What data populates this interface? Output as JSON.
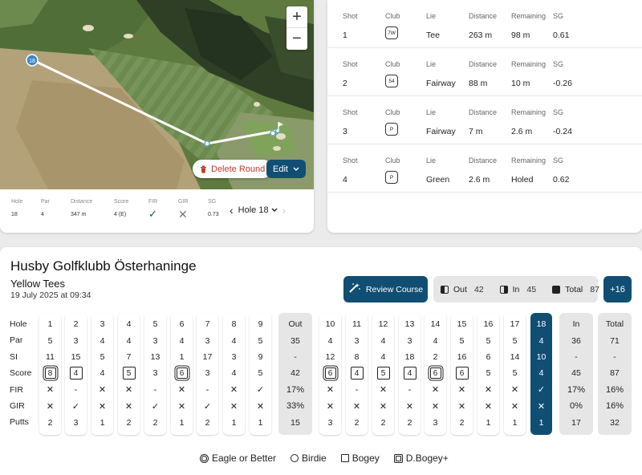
{
  "map": {
    "marker_label": "18",
    "zoom_in": "+",
    "zoom_out": "−",
    "delete_label": "Delete Round",
    "edit_label": "Edit"
  },
  "hole_stats": {
    "headers": [
      "Hole",
      "Par",
      "Distance",
      "Score",
      "FIR",
      "GIR",
      "SG"
    ],
    "hole": "18",
    "par": "4",
    "distance": "347 m",
    "score": "4 (E)",
    "fir": "✓",
    "gir": "✕",
    "sg": "0.73"
  },
  "hole_nav": {
    "label": "Hole 18",
    "prev": "‹",
    "next": "›"
  },
  "shots": {
    "headers": {
      "shot": "Shot",
      "club": "Club",
      "lie": "Lie",
      "distance": "Distance",
      "remaining": "Remaining",
      "sg": "SG"
    },
    "rows": [
      {
        "shot": "1",
        "club": "7W",
        "lie": "Tee",
        "distance": "263 m",
        "remaining": "98 m",
        "sg": "0.61"
      },
      {
        "shot": "2",
        "club": "54",
        "lie": "Fairway",
        "distance": "88 m",
        "remaining": "10 m",
        "sg": "-0.26"
      },
      {
        "shot": "3",
        "club": "P",
        "lie": "Fairway",
        "distance": "7 m",
        "remaining": "2.6 m",
        "sg": "-0.24"
      },
      {
        "shot": "4",
        "club": "P",
        "lie": "Green",
        "distance": "2.6 m",
        "remaining": "Holed",
        "sg": "0.62"
      }
    ]
  },
  "round": {
    "course": "Husby Golfklubb Österhaninge",
    "tees": "Yellow Tees",
    "date": "19 July 2025 at 09:34",
    "review_label": "Review Course",
    "out_label": "Out",
    "out_value": "42",
    "in_label": "In",
    "in_value": "45",
    "total_label": "Total",
    "total_value": "87",
    "plus_label": "+16"
  },
  "scorecard": {
    "row_labels": [
      "Hole",
      "Par",
      "SI",
      "Score",
      "FIR",
      "GIR",
      "Putts"
    ],
    "holes": [
      {
        "hole": "1",
        "par": "5",
        "si": "11",
        "score": "8",
        "mark": "dbogey",
        "fir": "✕",
        "gir": "✕",
        "putts": "2"
      },
      {
        "hole": "2",
        "par": "3",
        "si": "15",
        "score": "4",
        "mark": "bogey",
        "fir": "-",
        "gir": "✓",
        "putts": "3"
      },
      {
        "hole": "3",
        "par": "4",
        "si": "5",
        "score": "4",
        "mark": "",
        "fir": "✕",
        "gir": "✕",
        "putts": "1"
      },
      {
        "hole": "4",
        "par": "4",
        "si": "7",
        "score": "5",
        "mark": "bogey",
        "fir": "✕",
        "gir": "✕",
        "putts": "2"
      },
      {
        "hole": "5",
        "par": "3",
        "si": "13",
        "score": "3",
        "mark": "",
        "fir": "-",
        "gir": "✓",
        "putts": "2"
      },
      {
        "hole": "6",
        "par": "4",
        "si": "1",
        "score": "6",
        "mark": "dbogey",
        "fir": "✕",
        "gir": "✕",
        "putts": "1"
      },
      {
        "hole": "7",
        "par": "3",
        "si": "17",
        "score": "3",
        "mark": "",
        "fir": "-",
        "gir": "✓",
        "putts": "2"
      },
      {
        "hole": "8",
        "par": "4",
        "si": "3",
        "score": "4",
        "mark": "",
        "fir": "✕",
        "gir": "✕",
        "putts": "1"
      },
      {
        "hole": "9",
        "par": "5",
        "si": "9",
        "score": "5",
        "mark": "",
        "fir": "✓",
        "gir": "✕",
        "putts": "1"
      },
      {
        "hole": "10",
        "par": "4",
        "si": "12",
        "score": "6",
        "mark": "dbogey",
        "fir": "✕",
        "gir": "✕",
        "putts": "3"
      },
      {
        "hole": "11",
        "par": "3",
        "si": "8",
        "score": "4",
        "mark": "bogey",
        "fir": "-",
        "gir": "✕",
        "putts": "2"
      },
      {
        "hole": "12",
        "par": "4",
        "si": "4",
        "score": "5",
        "mark": "bogey",
        "fir": "✕",
        "gir": "✕",
        "putts": "2"
      },
      {
        "hole": "13",
        "par": "3",
        "si": "18",
        "score": "4",
        "mark": "bogey",
        "fir": "-",
        "gir": "✕",
        "putts": "2"
      },
      {
        "hole": "14",
        "par": "4",
        "si": "2",
        "score": "6",
        "mark": "dbogey",
        "fir": "✕",
        "gir": "✕",
        "putts": "3"
      },
      {
        "hole": "15",
        "par": "5",
        "si": "16",
        "score": "6",
        "mark": "bogey",
        "fir": "✕",
        "gir": "✕",
        "putts": "2"
      },
      {
        "hole": "16",
        "par": "5",
        "si": "6",
        "score": "5",
        "mark": "",
        "fir": "✕",
        "gir": "✕",
        "putts": "1"
      },
      {
        "hole": "17",
        "par": "5",
        "si": "14",
        "score": "5",
        "mark": "",
        "fir": "✕",
        "gir": "✕",
        "putts": "1"
      },
      {
        "hole": "18",
        "par": "4",
        "si": "10",
        "score": "4",
        "mark": "",
        "fir": "✓",
        "gir": "✕",
        "putts": "1"
      }
    ],
    "out": {
      "hole": "Out",
      "par": "35",
      "si": "-",
      "score": "42",
      "fir": "17%",
      "gir": "33%",
      "putts": "15"
    },
    "in": {
      "hole": "In",
      "par": "36",
      "si": "-",
      "score": "45",
      "fir": "17%",
      "gir": "0%",
      "putts": "17"
    },
    "total": {
      "hole": "Total",
      "par": "71",
      "si": "-",
      "score": "87",
      "fir": "16%",
      "gir": "16%",
      "putts": "32"
    },
    "current_hole": "18"
  },
  "legend": {
    "eagle": "Eagle or Better",
    "birdie": "Birdie",
    "bogey": "Bogey",
    "dbogey": "D.Bogey+"
  },
  "colors": {
    "accent": "#114e73",
    "delete": "#c0392b",
    "summary_bg": "#e6e6e6"
  },
  "icons": [
    "zoom-in-icon",
    "zoom-out-icon",
    "trash-icon",
    "chevron-down-icon",
    "chevron-left-icon",
    "chevron-right-icon",
    "check-icon",
    "cross-icon",
    "magic-wand-icon",
    "front-nine-icon",
    "back-nine-icon",
    "total-icon",
    "flag-icon",
    "hole-marker-icon"
  ]
}
